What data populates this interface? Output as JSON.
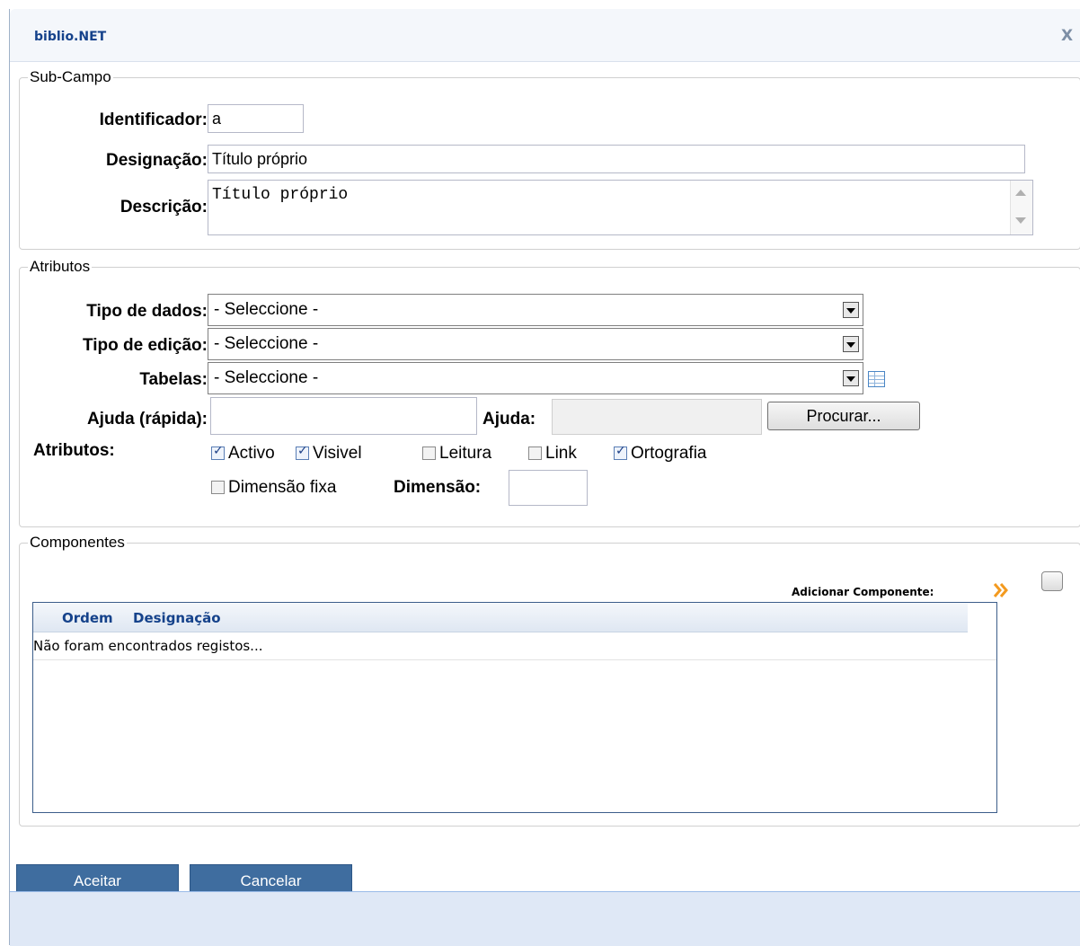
{
  "dialog": {
    "title": "biblio.NET",
    "close": "X"
  },
  "subcampo": {
    "legend": "Sub-Campo",
    "identificador_label": "Identificador:",
    "identificador_value": "a",
    "designacao_label": "Designação:",
    "designacao_value": "Título próprio",
    "descricao_label": "Descrição:",
    "descricao_value": "Título próprio"
  },
  "atributos": {
    "legend": "Atributos",
    "tipo_dados_label": "Tipo de dados:",
    "tipo_dados_value": "- Seleccione -",
    "tipo_edicao_label": "Tipo de edição:",
    "tipo_edicao_value": "- Seleccione -",
    "tabelas_label": "Tabelas:",
    "tabelas_value": "- Seleccione -",
    "tabelas_icon": "table-icon",
    "ajuda_rapida_label": "Ajuda (rápida):",
    "ajuda_rapida_value": "",
    "ajuda_label": "Ajuda:",
    "ajuda_value": "",
    "procurar_label": "Procurar...",
    "atributos_label": "Atributos:",
    "checkboxes": [
      {
        "label": "Activo",
        "checked": true
      },
      {
        "label": "Visivel",
        "checked": true
      },
      {
        "label": "Leitura",
        "checked": false
      },
      {
        "label": "Link",
        "checked": false
      },
      {
        "label": "Ortografia",
        "checked": true
      },
      {
        "label": "Dimensão fixa",
        "checked": false
      }
    ],
    "dimensao_label": "Dimensão:",
    "dimensao_value": ""
  },
  "componentes": {
    "legend": "Componentes",
    "add_label": "Adicionar Componente:",
    "add_icon": "double-chevron-right-icon",
    "columns": [
      "Ordem",
      "Designação"
    ],
    "empty_text": "Não foram encontrados registos..."
  },
  "actions": {
    "aceitar": "Aceitar",
    "cancelar": "Cancelar"
  },
  "colors": {
    "accent": "#3f6d9f",
    "header_text": "#15428b",
    "footer_bar": "#dfe8f6",
    "chevron": "#f39a1f"
  }
}
